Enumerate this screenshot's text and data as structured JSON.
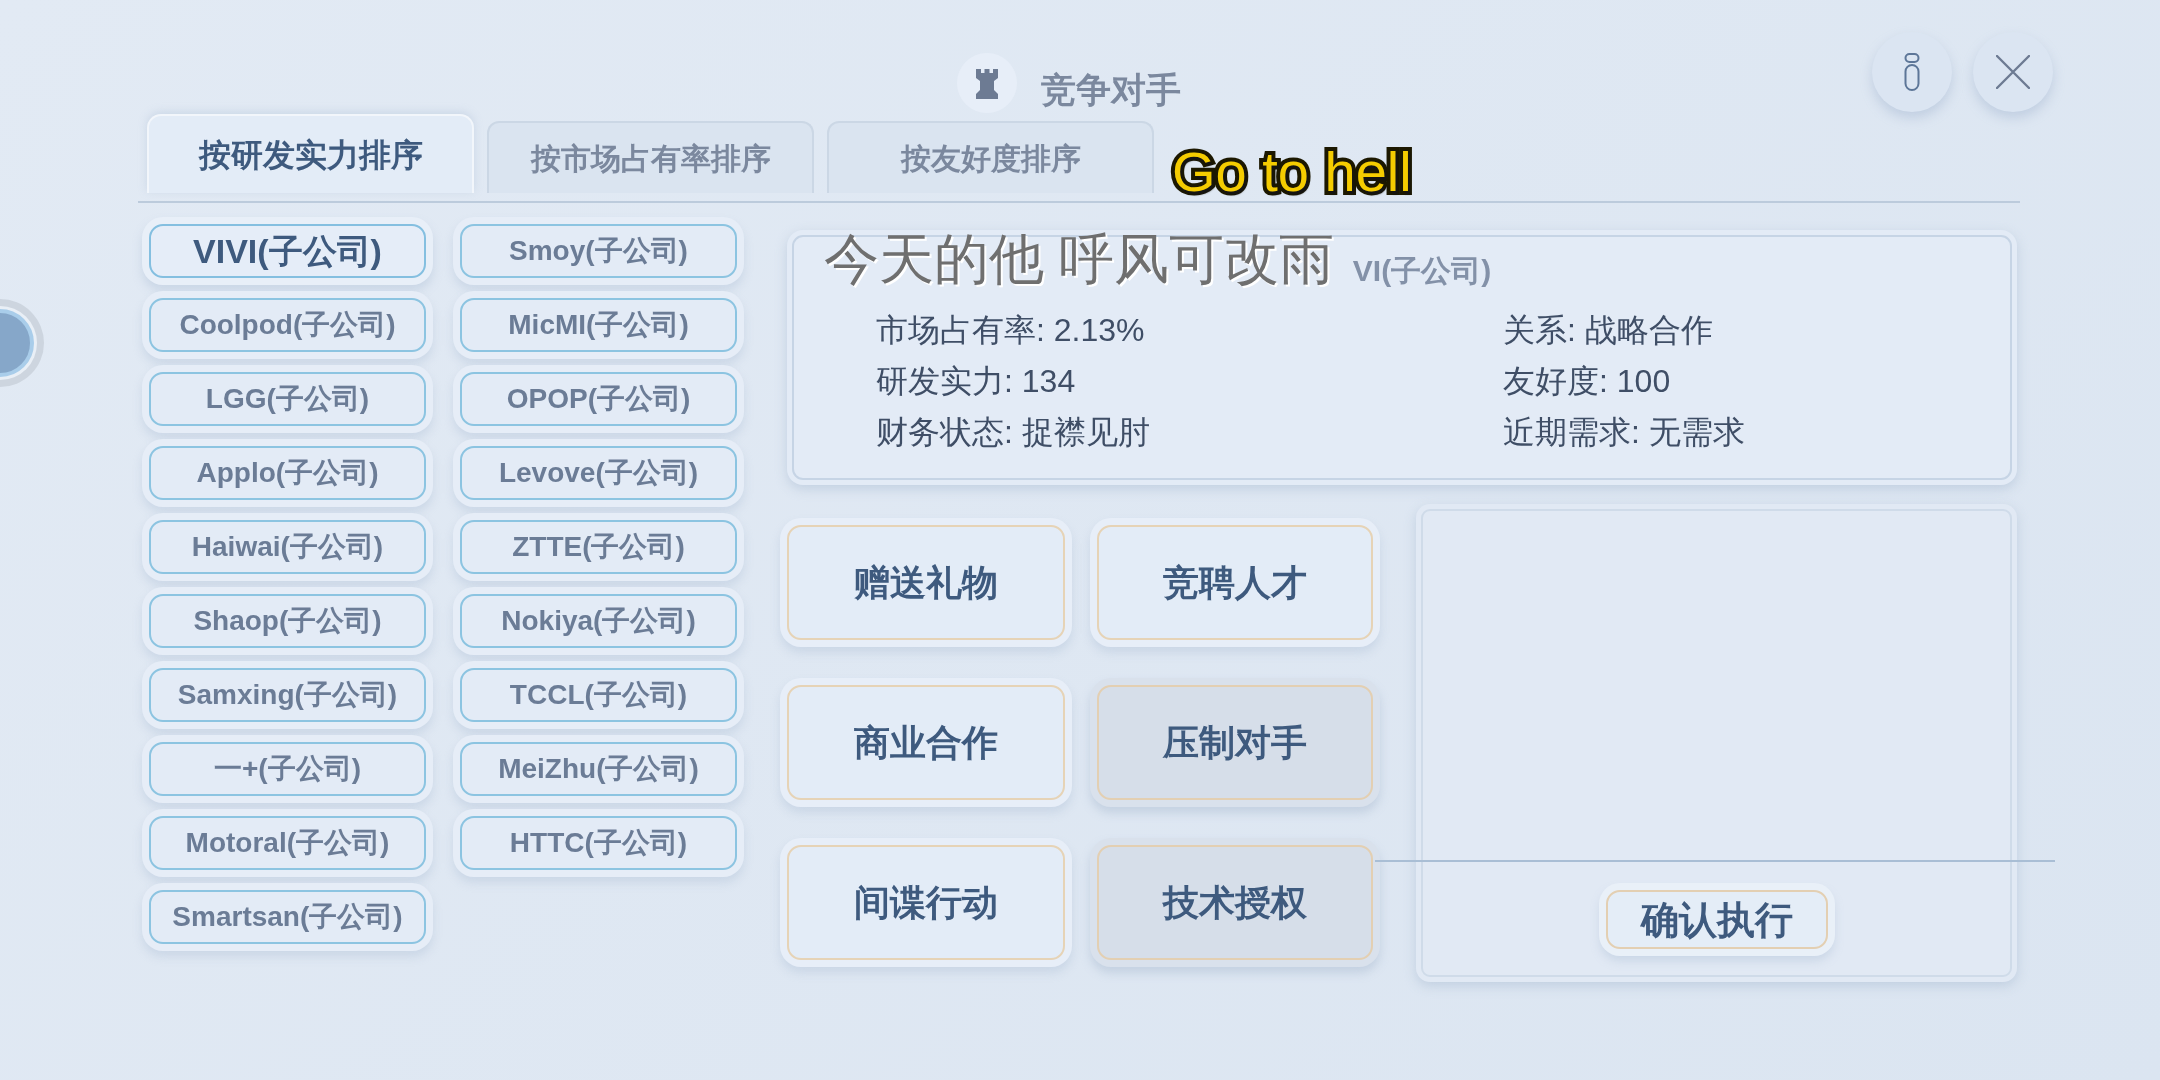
{
  "header": {
    "title": "竞争对手"
  },
  "tabs": [
    {
      "label": "按研发实力排序",
      "selected": true
    },
    {
      "label": "按市场占有率排序",
      "selected": false
    },
    {
      "label": "按友好度排序",
      "selected": false
    }
  ],
  "companies": [
    {
      "name": "VIVI(子公司)",
      "selected": true
    },
    {
      "name": "Smoy(子公司)",
      "selected": false
    },
    {
      "name": "Coolpod(子公司)",
      "selected": false
    },
    {
      "name": "MicMI(子公司)",
      "selected": false
    },
    {
      "name": "LGG(子公司)",
      "selected": false
    },
    {
      "name": "OPOP(子公司)",
      "selected": false
    },
    {
      "name": "Applo(子公司)",
      "selected": false
    },
    {
      "name": "Levove(子公司)",
      "selected": false
    },
    {
      "name": "Haiwai(子公司)",
      "selected": false
    },
    {
      "name": "ZTTE(子公司)",
      "selected": false
    },
    {
      "name": "Shaop(子公司)",
      "selected": false
    },
    {
      "name": "Nokiya(子公司)",
      "selected": false
    },
    {
      "name": "Samxing(子公司)",
      "selected": false
    },
    {
      "name": "TCCL(子公司)",
      "selected": false
    },
    {
      "name": "一+(子公司)",
      "selected": false
    },
    {
      "name": "MeiZhu(子公司)",
      "selected": false
    },
    {
      "name": "Motoral(子公司)",
      "selected": false
    },
    {
      "name": "HTTC(子公司)",
      "selected": false
    },
    {
      "name": "Smartsan(子公司)",
      "selected": false
    }
  ],
  "detail": {
    "title": "VI(子公司)",
    "fields": [
      "市场占有率: 2.13%",
      "关系: 战略合作",
      "研发实力: 134",
      "友好度: 100",
      "财务状态: 捉襟见肘",
      "近期需求: 无需求"
    ]
  },
  "actions": [
    {
      "label": "赠送礼物",
      "disabled": false
    },
    {
      "label": "竞聘人才",
      "disabled": false
    },
    {
      "label": "商业合作",
      "disabled": false
    },
    {
      "label": "压制对手",
      "disabled": true
    },
    {
      "label": "间谍行动",
      "disabled": false
    },
    {
      "label": "技术授权",
      "disabled": true
    }
  ],
  "confirm_button": {
    "label": "确认执行"
  },
  "overlay_texts": [
    {
      "kind": "caption",
      "text": "Go to hell"
    },
    {
      "kind": "subtitle",
      "text": "今天的他 呼风可改雨"
    }
  ]
}
